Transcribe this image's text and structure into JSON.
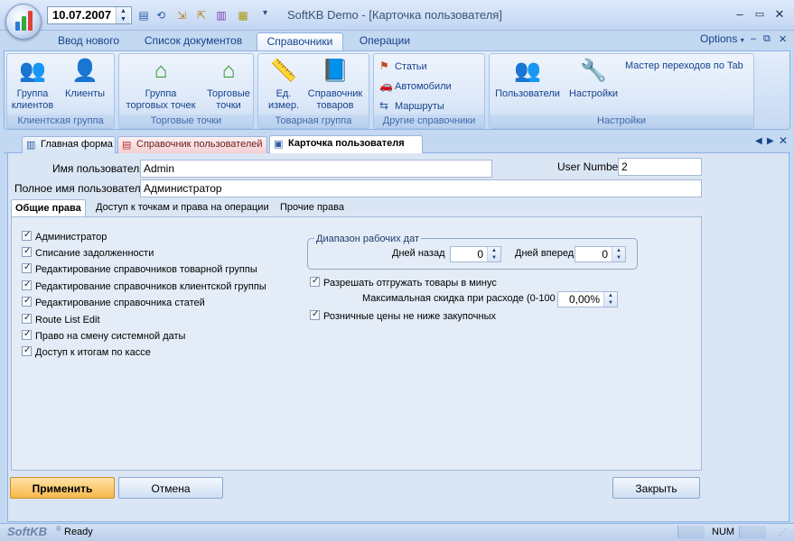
{
  "app": {
    "window_title": "SoftKB Demo - [Карточка пользователя]",
    "date": "10.07.2007"
  },
  "ribbon": {
    "tabs": [
      "Ввод нового",
      "Список документов",
      "Справочники",
      "Операции"
    ],
    "active_tab": "Справочники",
    "options": "Options",
    "groups": {
      "client": {
        "label": "Клиентская группа",
        "client_group": [
          "Группа",
          "клиентов"
        ],
        "clients": "Клиенты"
      },
      "points": {
        "label": "Торговые точки",
        "point_group": [
          "Группа",
          "торговых точек"
        ],
        "points": [
          "Торговые",
          "точки"
        ]
      },
      "goods": {
        "label": "Товарная группа",
        "units": [
          "Ед.",
          "измер."
        ],
        "catalog": [
          "Справочник",
          "товаров"
        ]
      },
      "other": {
        "label": "Другие справочники",
        "articles": "Статьи",
        "cars": "Автомобили",
        "routes": "Маршруты"
      },
      "settings": {
        "label": "Настройки",
        "users": "Пользователи",
        "settings": "Настройки",
        "tab_wizard": "Мастер переходов по Tab"
      }
    }
  },
  "doc_tabs": [
    "Главная форма",
    "Справочник пользователей",
    "Карточка пользователя"
  ],
  "form": {
    "username_label": "Имя пользователя",
    "username_value": "Admin",
    "user_number_label": "User Number",
    "user_number_value": "2",
    "fullname_label": "Полное имя пользователя",
    "fullname_value": "Администратор"
  },
  "inner_tabs": [
    "Общие права",
    "Доступ к точкам и права на операции",
    "Прочие права"
  ],
  "rights": [
    "Администратор",
    "Списание задолженности",
    "Редактирование справочников товарной группы",
    "Редактирование справочников клиентской группы",
    "Редактирование справочника статей",
    "Route List Edit",
    "Право на смену системной даты",
    "Доступ к итогам по кассе"
  ],
  "date_range": {
    "title": "Диапазон рабочих дат",
    "days_back_label": "Дней назад",
    "days_back_value": "0",
    "days_forward_label": "Дней вперед",
    "days_forward_value": "0"
  },
  "options": {
    "allow_negative": "Разрешать отгружать товары в минус",
    "max_discount_label": "Максимальная скидка при расходе (0-100",
    "max_discount_value": "0,00%",
    "retail_not_below": "Розничные цены не ниже закупочных"
  },
  "buttons": {
    "apply": "Применить",
    "cancel": "Отмена",
    "close": "Закрыть"
  },
  "status": {
    "brand": "SoftKB",
    "text": "Ready",
    "num": "NUM"
  }
}
